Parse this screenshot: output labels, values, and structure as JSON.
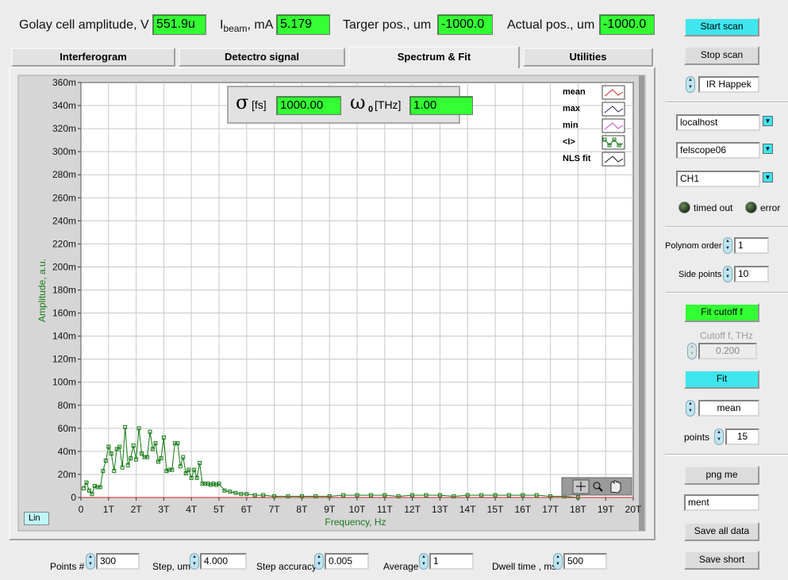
{
  "header": {
    "golay_label": "Golay cell amplitude, V",
    "golay_value": "551.9u",
    "ibeam_label_i": "I",
    "ibeam_label_sub": "beam",
    "ibeam_label_unit": ", mA",
    "ibeam_value": "5.179",
    "target_label": "Targer pos., um",
    "target_value": "-1000.0",
    "actual_label": "Actual pos., um",
    "actual_value": "-1000.0"
  },
  "tabs": [
    {
      "label": "Interferogram"
    },
    {
      "label": "Detectro signal"
    },
    {
      "label": "Spectrum & Fit"
    },
    {
      "label": "Utilities"
    }
  ],
  "fit_box": {
    "sigma_symbol": "σ",
    "sigma_unit": "[fs]",
    "sigma_value": "1000.00",
    "omega_symbol": "ω",
    "omega_sub": "0",
    "omega_unit": "[THz]",
    "omega_value": "1.00"
  },
  "legend": [
    {
      "label": "mean",
      "color": "#cc2222"
    },
    {
      "label": "max",
      "color": "#222266"
    },
    {
      "label": "min",
      "color": "#cc44cc"
    },
    {
      "label": "<I>",
      "color": "#117711"
    },
    {
      "label": "NLS fit",
      "color": "#111111"
    }
  ],
  "chart_scale_label": "Lin",
  "chart_data": {
    "type": "line",
    "xlabel": "Frequency, Hz",
    "ylabel": "Amplitude, a.u.",
    "xlim": [
      0,
      20
    ],
    "ylim": [
      0,
      360
    ],
    "x_unit": "THz",
    "y_unit": "milli",
    "x_ticks": [
      "0",
      "1T",
      "2T",
      "3T",
      "4T",
      "5T",
      "6T",
      "7T",
      "8T",
      "9T",
      "10T",
      "11T",
      "12T",
      "13T",
      "14T",
      "15T",
      "16T",
      "17T",
      "18T",
      "19T",
      "20T"
    ],
    "y_ticks": [
      "0",
      "20m",
      "40m",
      "60m",
      "80m",
      "100m",
      "120m",
      "140m",
      "160m",
      "180m",
      "200m",
      "220m",
      "240m",
      "260m",
      "280m",
      "300m",
      "320m",
      "340m",
      "360m"
    ],
    "grid": true,
    "series": [
      {
        "name": "<I>",
        "color": "#117711",
        "x": [
          0.1,
          0.2,
          0.3,
          0.4,
          0.5,
          0.6,
          0.7,
          0.8,
          0.9,
          1.0,
          1.1,
          1.2,
          1.3,
          1.4,
          1.5,
          1.6,
          1.7,
          1.8,
          1.9,
          2.0,
          2.1,
          2.2,
          2.3,
          2.4,
          2.5,
          2.6,
          2.7,
          2.8,
          2.9,
          3.0,
          3.1,
          3.2,
          3.3,
          3.4,
          3.5,
          3.6,
          3.7,
          3.8,
          3.9,
          4.0,
          4.1,
          4.2,
          4.3,
          4.4,
          4.5,
          4.6,
          4.7,
          4.8,
          4.9,
          5.0,
          5.2,
          5.4,
          5.6,
          5.8,
          6.0,
          6.3,
          6.6,
          7.0,
          7.5,
          8.0,
          8.5,
          9.0,
          9.5,
          10.0,
          10.5,
          11.0,
          11.5,
          12.0,
          12.5,
          13.0,
          13.5,
          14.0,
          14.5,
          15.0,
          15.5,
          16.0,
          16.5,
          17.0,
          17.5,
          18.0
        ],
        "y": [
          8,
          13,
          6,
          3,
          10,
          9,
          9,
          23,
          32,
          44,
          38,
          23,
          42,
          44,
          26,
          61,
          28,
          34,
          45,
          33,
          60,
          38,
          35,
          35,
          57,
          42,
          47,
          31,
          34,
          52,
          23,
          24,
          24,
          47,
          47,
          27,
          35,
          21,
          24,
          17,
          24,
          17,
          30,
          12,
          12,
          12,
          11,
          12,
          11,
          12,
          6,
          5,
          4,
          3,
          3,
          2,
          2,
          1,
          1,
          1,
          1,
          1,
          2,
          2,
          2,
          2,
          1,
          2,
          2,
          2,
          1,
          2,
          2,
          2,
          2,
          2,
          2,
          1,
          1,
          0
        ]
      },
      {
        "name": "NLS fit",
        "color": "#cc2222",
        "x": [
          0,
          20
        ],
        "y": [
          0,
          0
        ]
      }
    ]
  },
  "right": {
    "start_scan": "Start scan",
    "stop_scan": "Stop scan",
    "source": "IR Happek",
    "host": "localhost",
    "scope": "felscope06",
    "channel": "CH1",
    "timed_out": "timed out",
    "error": "error",
    "polynom_label": "Polynom order",
    "polynom_value": "1",
    "side_label": "Side points",
    "side_value": "10",
    "fit_cutoff": "Fit cutoff f",
    "cutoff_label": "Cutoff f, THz",
    "cutoff_value": "0.200",
    "fit": "Fit",
    "mode": "mean",
    "points_label": "points",
    "points_value": "15",
    "png": "png me",
    "comment": "ment",
    "save_all": "Save all data",
    "save_short": "Save short"
  },
  "bottom": {
    "points_label": "Points #",
    "points_value": "300",
    "step_label": "Step, um",
    "step_value": "4.000",
    "accuracy_label": "Step accuracy",
    "accuracy_value": "0.005",
    "average_label": "Average",
    "average_value": "1",
    "dwell_label": "Dwell time , ms",
    "dwell_value": "500"
  }
}
